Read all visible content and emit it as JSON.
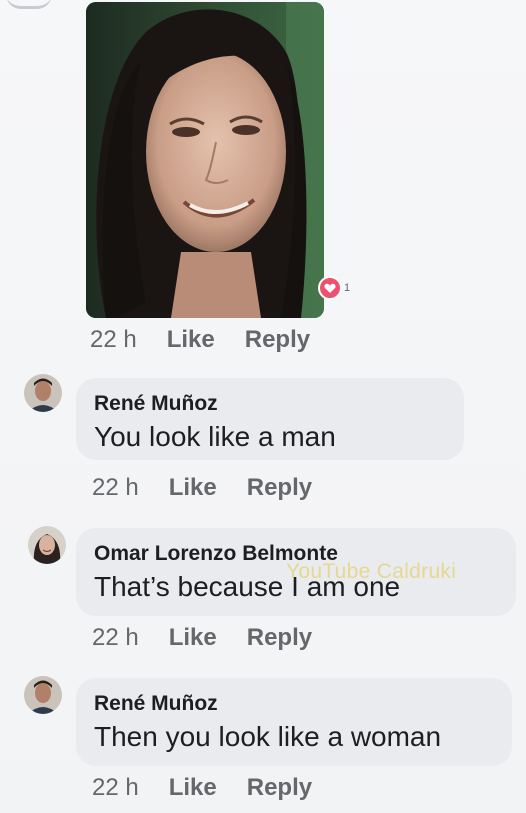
{
  "post": {
    "reaction_count": "1",
    "time": "22 h",
    "like_label": "Like",
    "reply_label": "Reply"
  },
  "comments": [
    {
      "author": "René Muñoz",
      "text": "You look like a man",
      "time": "22 h",
      "like_label": "Like",
      "reply_label": "Reply"
    },
    {
      "author": "Omar Lorenzo Belmonte",
      "text": "That’s because I am one",
      "time": "22 h",
      "like_label": "Like",
      "reply_label": "Reply"
    },
    {
      "author": "René Muñoz",
      "text": "Then you look like a woman",
      "time": "22 h",
      "like_label": "Like",
      "reply_label": "Reply"
    }
  ],
  "watermark": "YouTube Caldruki",
  "colors": {
    "bubble": "#e9ebee",
    "meta_text": "#65676b",
    "reaction": "#f0506e"
  }
}
